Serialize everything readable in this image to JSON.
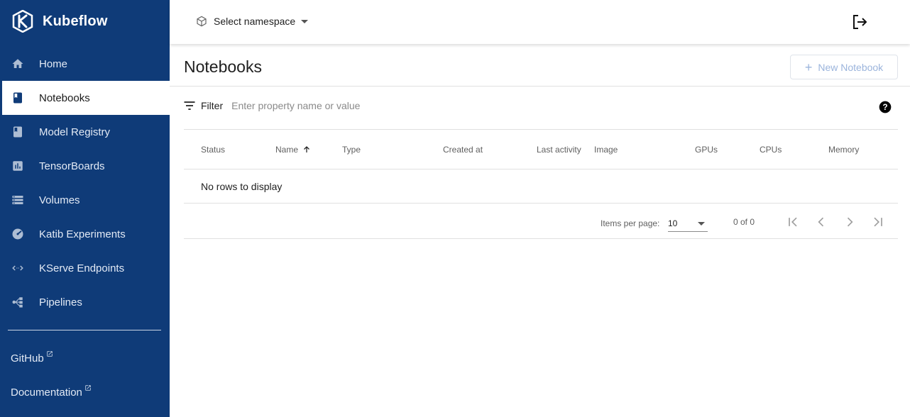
{
  "brand": {
    "name": "Kubeflow"
  },
  "sidebar": {
    "items": [
      {
        "label": "Home",
        "icon": "home-icon"
      },
      {
        "label": "Notebooks",
        "icon": "book-icon",
        "active": true
      },
      {
        "label": "Model Registry",
        "icon": "book-icon"
      },
      {
        "label": "TensorBoards",
        "icon": "chart-icon"
      },
      {
        "label": "Volumes",
        "icon": "storage-icon"
      },
      {
        "label": "Katib Experiments",
        "icon": "speed-icon"
      },
      {
        "label": "KServe Endpoints",
        "icon": "code-arrows-icon"
      },
      {
        "label": "Pipelines",
        "icon": "pipeline-icon"
      }
    ],
    "links": [
      {
        "label": "GitHub",
        "icon": "external-link-icon"
      },
      {
        "label": "Documentation",
        "icon": "external-link-icon"
      }
    ]
  },
  "topbar": {
    "namespace_placeholder": "Select namespace",
    "logout_icon": "logout-icon"
  },
  "page": {
    "title": "Notebooks",
    "new_button_label": "New Notebook",
    "filter_label": "Filter",
    "filter_placeholder": "Enter property name or value"
  },
  "table": {
    "columns": [
      "Status",
      "Name",
      "Type",
      "Created at",
      "Last activity",
      "Image",
      "GPUs",
      "CPUs",
      "Memory"
    ],
    "sorted_column": "Name",
    "sort_direction": "ascending",
    "empty_message": "No rows to display"
  },
  "paginator": {
    "items_per_page_label": "Items per page:",
    "items_per_page": "10",
    "range_label": "0 of 0"
  },
  "colors": {
    "sidebar_bg": "#0f3b78",
    "accent_disabled": "#9bb4dc"
  }
}
